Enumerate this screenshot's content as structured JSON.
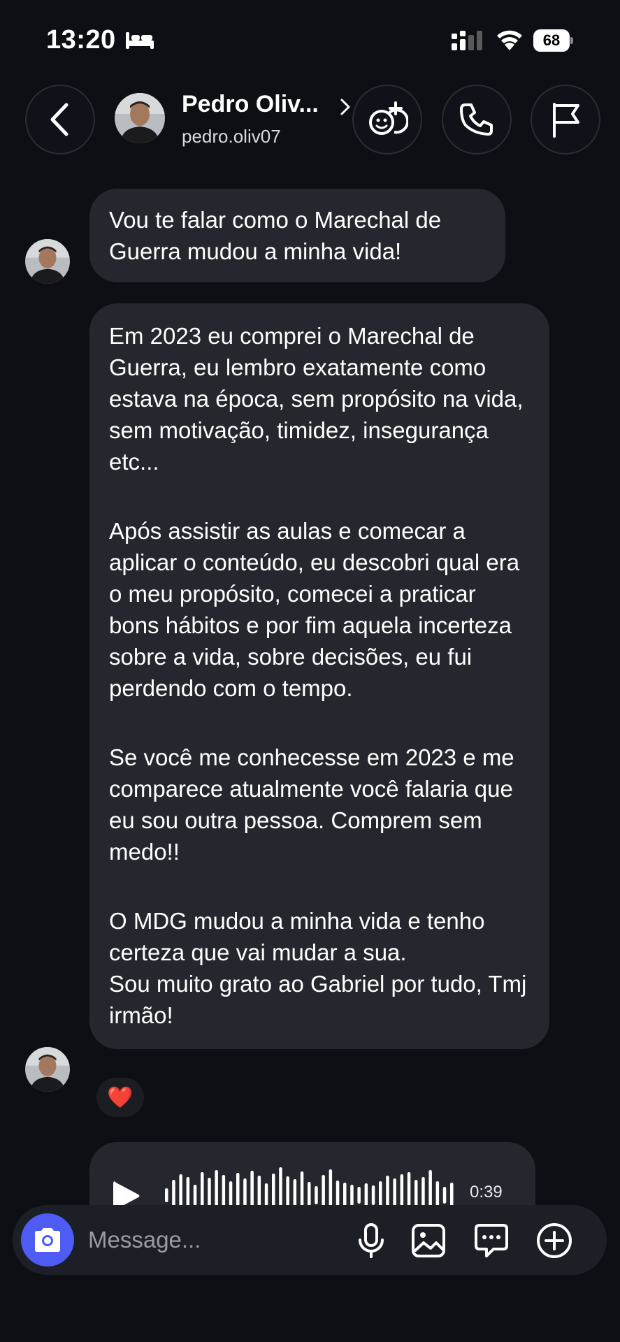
{
  "status_bar": {
    "time": "13:20",
    "battery": "68",
    "icons": [
      "bed-icon",
      "signal-icon",
      "wifi-icon",
      "battery-icon"
    ]
  },
  "header": {
    "name": "Pedro Oliv...",
    "username": "pedro.oliv07",
    "icons": [
      "back-arrow-icon",
      "chevron-right-icon",
      "add-meet-icon",
      "phone-icon",
      "flag-icon"
    ]
  },
  "messages": [
    {
      "paragraphs": [
        "Vou te falar como o Marechal de Guerra mudou a minha vida!"
      ]
    },
    {
      "paragraphs": [
        "Em 2023 eu comprei o Marechal de Guerra, eu lembro exatamente como estava na época, sem propósito na vida, sem motivação, timidez, insegurança etc...",
        "Após assistir as aulas e comecar a aplicar o conteúdo, eu descobri qual era o meu propósito, comecei a praticar bons hábitos e por fim aquela incerteza sobre a vida, sobre decisões, eu fui perdendo com o tempo.",
        "Se você me conhecesse em 2023 e me comparece atualmente você falaria que eu sou outra pessoa. Comprem sem medo!!",
        "O MDG mudou a minha vida e tenho certeza que vai mudar a sua.\nSou muito grato ao Gabriel por tudo, Tmj irmão!"
      ],
      "reaction": "❤️"
    }
  ],
  "voice_message": {
    "duration": "0:39",
    "icon": "play-icon"
  },
  "composer": {
    "placeholder": "Message...",
    "icons": [
      "camera-icon",
      "microphone-icon",
      "gallery-icon",
      "sticker-icon",
      "plus-icon"
    ]
  },
  "colors": {
    "background": "#0d0f14",
    "bubble": "#25272e",
    "camera_button": "#4f5bf5",
    "composer": "#1c1f26"
  }
}
